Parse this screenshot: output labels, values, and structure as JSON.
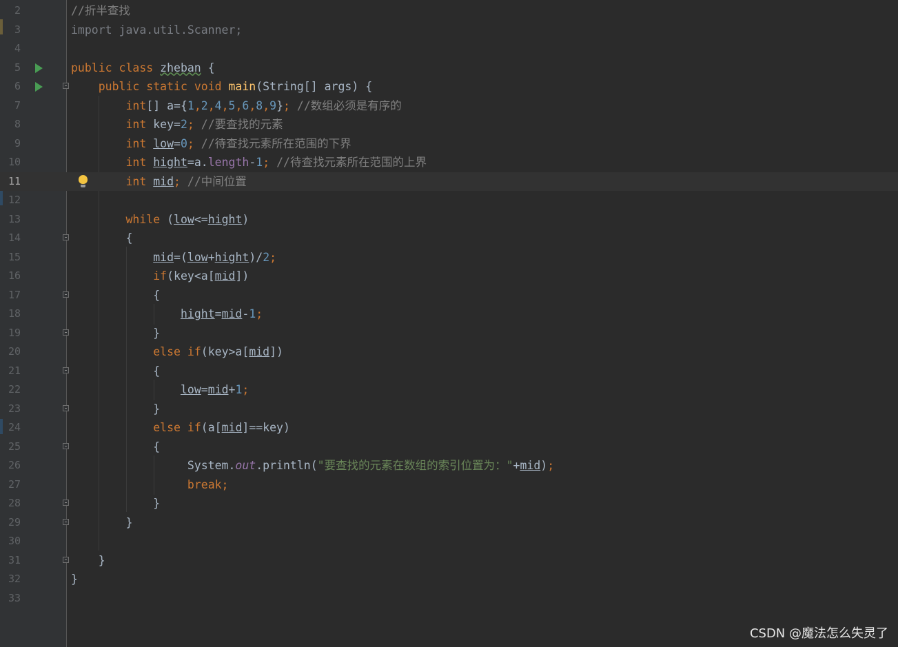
{
  "watermark": "CSDN @魔法怎么失灵了",
  "current_line": 11,
  "lines": [
    {
      "n": 2,
      "tokens": [
        [
          "cm",
          "//折半查找"
        ]
      ]
    },
    {
      "n": 3,
      "tokens": [
        [
          "dim",
          "import java.util.Scanner;"
        ]
      ]
    },
    {
      "n": 4,
      "tokens": []
    },
    {
      "n": 5,
      "icon": "run-icon",
      "tokens": [
        [
          "kw",
          "public class "
        ],
        [
          "wavy",
          "zheban"
        ],
        [
          "",
          " {"
        ]
      ]
    },
    {
      "n": 6,
      "icon": "run-icon",
      "fold": true,
      "tokens": [
        [
          "",
          "    "
        ],
        [
          "kw",
          "public static void "
        ],
        [
          "fn",
          "main"
        ],
        [
          "",
          "(String[] args) {"
        ]
      ]
    },
    {
      "n": 7,
      "tokens": [
        [
          "",
          "        "
        ],
        [
          "kw",
          "int"
        ],
        [
          "",
          "[] a={"
        ],
        [
          "num",
          "1"
        ],
        [
          "kw",
          ","
        ],
        [
          "num",
          "2"
        ],
        [
          "kw",
          ","
        ],
        [
          "num",
          "4"
        ],
        [
          "kw",
          ","
        ],
        [
          "num",
          "5"
        ],
        [
          "kw",
          ","
        ],
        [
          "num",
          "6"
        ],
        [
          "kw",
          ","
        ],
        [
          "num",
          "8"
        ],
        [
          "kw",
          ","
        ],
        [
          "num",
          "9"
        ],
        [
          "",
          "}"
        ],
        [
          "kw",
          "; "
        ],
        [
          "cm",
          "//数组必须是有序的"
        ]
      ]
    },
    {
      "n": 8,
      "tokens": [
        [
          "",
          "        "
        ],
        [
          "kw",
          "int "
        ],
        [
          "",
          "key="
        ],
        [
          "num",
          "2"
        ],
        [
          "kw",
          "; "
        ],
        [
          "cm",
          "//要查找的元素"
        ]
      ]
    },
    {
      "n": 9,
      "tokens": [
        [
          "",
          "        "
        ],
        [
          "kw",
          "int "
        ],
        [
          "ul",
          "low"
        ],
        [
          "",
          "="
        ],
        [
          "num",
          "0"
        ],
        [
          "kw",
          "; "
        ],
        [
          "cm",
          "//待查找元素所在范围的下界"
        ]
      ]
    },
    {
      "n": 10,
      "tokens": [
        [
          "",
          "        "
        ],
        [
          "kw",
          "int "
        ],
        [
          "ul",
          "hight"
        ],
        [
          "",
          "=a."
        ],
        [
          "fld",
          "length"
        ],
        [
          "",
          "-"
        ],
        [
          "num",
          "1"
        ],
        [
          "kw",
          "; "
        ],
        [
          "cm",
          "//待查找元素所在范围的上界"
        ]
      ]
    },
    {
      "n": 11,
      "icon": "bulb-icon",
      "tokens": [
        [
          "",
          "        "
        ],
        [
          "kw",
          "int "
        ],
        [
          "ul",
          "mid"
        ],
        [
          "kw",
          "; "
        ],
        [
          "cm",
          "//中间位置"
        ]
      ]
    },
    {
      "n": 12,
      "tokens": []
    },
    {
      "n": 13,
      "tokens": [
        [
          "",
          "        "
        ],
        [
          "kw",
          "while "
        ],
        [
          "",
          "("
        ],
        [
          "ul",
          "low"
        ],
        [
          "",
          "<="
        ],
        [
          "ul",
          "hight"
        ],
        [
          "",
          ")"
        ]
      ]
    },
    {
      "n": 14,
      "fold": true,
      "tokens": [
        [
          "",
          "        {"
        ]
      ]
    },
    {
      "n": 15,
      "tokens": [
        [
          "",
          "            "
        ],
        [
          "ul",
          "mid"
        ],
        [
          "",
          "=("
        ],
        [
          "ul",
          "low"
        ],
        [
          "",
          "+"
        ],
        [
          "ul",
          "hight"
        ],
        [
          "",
          ")/"
        ],
        [
          "num",
          "2"
        ],
        [
          "kw",
          ";"
        ]
      ]
    },
    {
      "n": 16,
      "tokens": [
        [
          "",
          "            "
        ],
        [
          "kw",
          "if"
        ],
        [
          "",
          "(key<a["
        ],
        [
          "ul",
          "mid"
        ],
        [
          "",
          "])"
        ]
      ]
    },
    {
      "n": 17,
      "fold": true,
      "tokens": [
        [
          "",
          "            {"
        ]
      ]
    },
    {
      "n": 18,
      "tokens": [
        [
          "",
          "                "
        ],
        [
          "ul",
          "hight"
        ],
        [
          "",
          "="
        ],
        [
          "ul",
          "mid"
        ],
        [
          "",
          "-"
        ],
        [
          "num",
          "1"
        ],
        [
          "kw",
          ";"
        ]
      ]
    },
    {
      "n": 19,
      "fold": true,
      "tokens": [
        [
          "",
          "            }"
        ]
      ]
    },
    {
      "n": 20,
      "tokens": [
        [
          "",
          "            "
        ],
        [
          "kw",
          "else if"
        ],
        [
          "",
          "(key>a["
        ],
        [
          "ul",
          "mid"
        ],
        [
          "",
          "])"
        ]
      ]
    },
    {
      "n": 21,
      "fold": true,
      "tokens": [
        [
          "",
          "            {"
        ]
      ]
    },
    {
      "n": 22,
      "tokens": [
        [
          "",
          "                "
        ],
        [
          "ul",
          "low"
        ],
        [
          "",
          "="
        ],
        [
          "ul",
          "mid"
        ],
        [
          "",
          "+"
        ],
        [
          "num",
          "1"
        ],
        [
          "kw",
          ";"
        ]
      ]
    },
    {
      "n": 23,
      "fold": true,
      "tokens": [
        [
          "",
          "            }"
        ]
      ]
    },
    {
      "n": 24,
      "tokens": [
        [
          "",
          "            "
        ],
        [
          "kw",
          "else if"
        ],
        [
          "",
          "(a["
        ],
        [
          "ul",
          "mid"
        ],
        [
          "",
          "]==key)"
        ]
      ]
    },
    {
      "n": 25,
      "fold": true,
      "tokens": [
        [
          "",
          "            {"
        ]
      ]
    },
    {
      "n": 26,
      "tokens": [
        [
          "",
          "                 System."
        ],
        [
          "st",
          "out"
        ],
        [
          "",
          ".println("
        ],
        [
          "str",
          "\"要查找的元素在数组的索引位置为：\""
        ],
        [
          "",
          "+"
        ],
        [
          "ul",
          "mid"
        ],
        [
          "",
          ")"
        ],
        [
          "kw",
          ";"
        ]
      ]
    },
    {
      "n": 27,
      "tokens": [
        [
          "",
          "                 "
        ],
        [
          "kw",
          "break;"
        ]
      ]
    },
    {
      "n": 28,
      "fold": true,
      "tokens": [
        [
          "",
          "            }"
        ]
      ]
    },
    {
      "n": 29,
      "fold": true,
      "tokens": [
        [
          "",
          "        }"
        ]
      ]
    },
    {
      "n": 30,
      "tokens": []
    },
    {
      "n": 31,
      "fold": true,
      "tokens": [
        [
          "",
          "    }"
        ]
      ]
    },
    {
      "n": 32,
      "tokens": [
        [
          "",
          "}"
        ]
      ]
    },
    {
      "n": 33,
      "tokens": []
    }
  ]
}
